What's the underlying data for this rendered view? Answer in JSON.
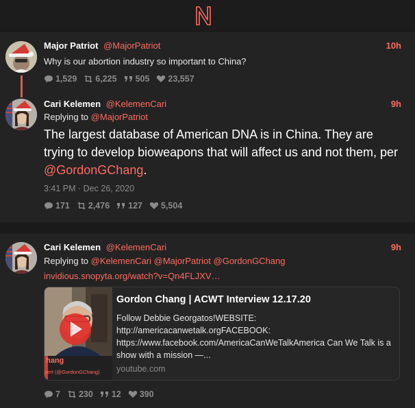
{
  "app": {
    "logo_letter": "N"
  },
  "thread1": {
    "parent": {
      "fullname": "Major Patriot",
      "handle": "@MajorPatriot",
      "time": "10h",
      "text": "Why is our abortion industry so important to China?",
      "stats": {
        "replies": "1,529",
        "retweets": "6,225",
        "quotes": "505",
        "likes": "23,557"
      }
    },
    "reply": {
      "fullname": "Cari Kelemen",
      "handle": "@KelemenCari",
      "time": "9h",
      "replying_prefix": "Replying to",
      "replying_to": "@MajorPatriot",
      "text_main": "The largest database of American DNA is in China. They are trying to develop bioweapons that will affect us and not them, per",
      "mention": "@GordonGChang",
      "text_end": ".",
      "date": "3:41 PM · Dec 26, 2020",
      "stats": {
        "replies": "171",
        "retweets": "2,476",
        "quotes": "127",
        "likes": "5,504"
      }
    }
  },
  "thread2": {
    "tweet": {
      "fullname": "Cari Kelemen",
      "handle": "@KelemenCari",
      "time": "9h",
      "replying_prefix": "Replying to",
      "replying_to": "@KelemenCari @MajorPatriot @GordonGChang",
      "link": "invidious.snopyta.org/watch?v=Qn4FLJXV…",
      "card": {
        "title": "Gordon Chang | ACWT Interview 12.17.20",
        "description": "Follow Debbie Georgatos!WEBSITE: http://americacanwetalk.orgFACEBOOK: https://www.facebook.com/AmericaCanWeTalkAmerica Can We Talk is a show with a mission —...",
        "domain": "youtube.com",
        "thumb_caption_name": "hang",
        "thumb_caption_sub": "pert (@GordonGChang)"
      },
      "stats": {
        "replies": "7",
        "retweets": "230",
        "quotes": "12",
        "likes": "390"
      }
    }
  },
  "colors": {
    "accent": "#ff6c60",
    "background": "#1c1c1c",
    "panel": "#232323",
    "muted": "#8b8b8b"
  }
}
